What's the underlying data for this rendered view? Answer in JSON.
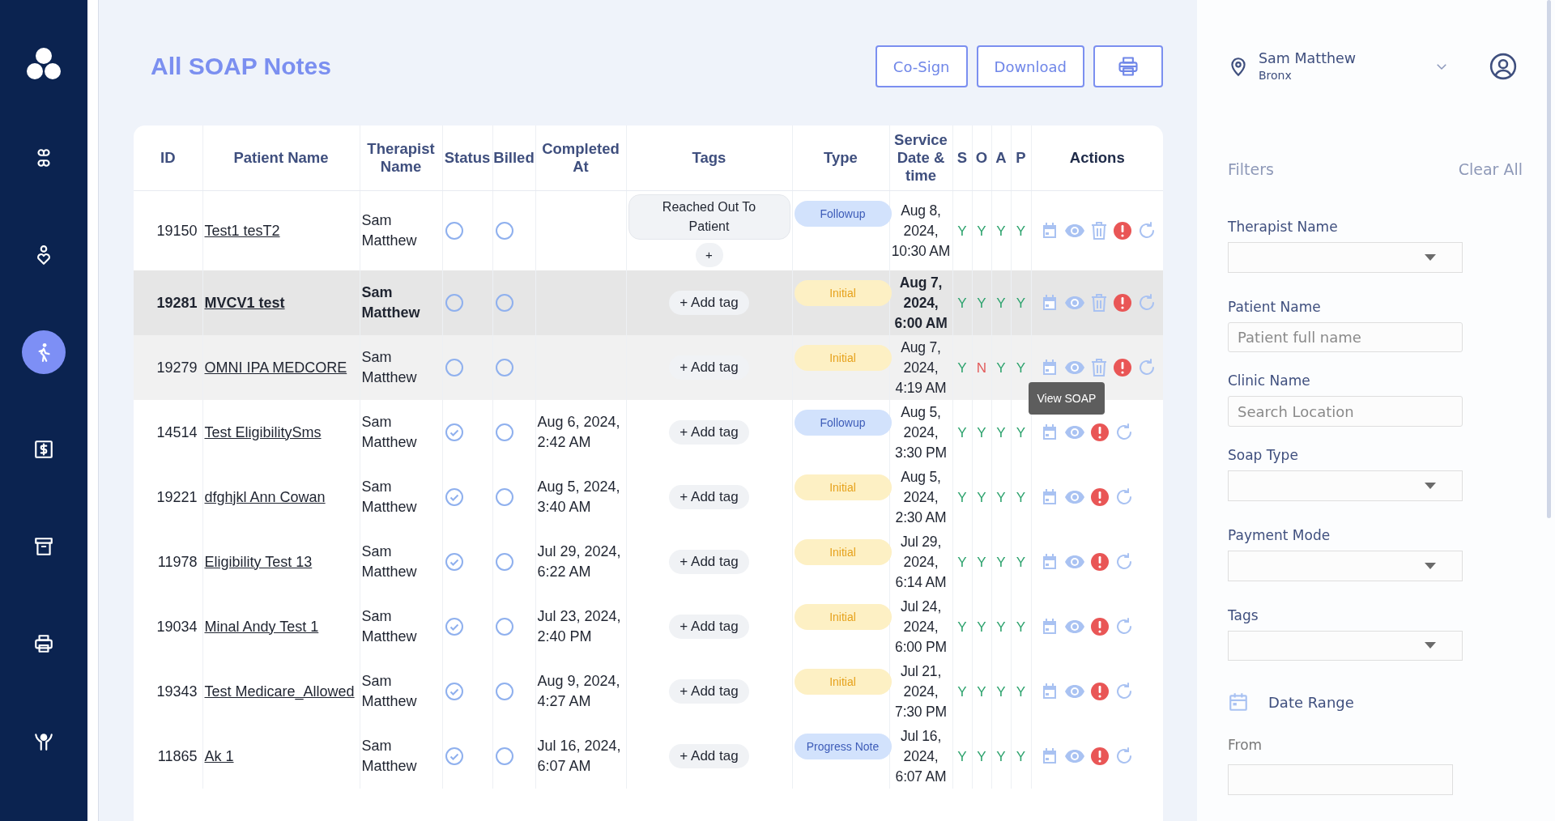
{
  "sidebar": {
    "items": [
      {
        "selected": false
      },
      {
        "selected": false
      },
      {
        "selected": true
      },
      {
        "selected": false
      },
      {
        "selected": false
      },
      {
        "selected": false
      },
      {
        "selected": false
      }
    ]
  },
  "page": {
    "title": "All SOAP Notes",
    "buttons": [
      "Co-Sign",
      "Download"
    ]
  },
  "table": {
    "columns": [
      "ID",
      "Patient Name",
      "Therapist Name",
      "Status",
      "Billed",
      "Completed At",
      "Tags",
      "Type",
      "Service Date & time",
      "S",
      "O",
      "A",
      "P",
      "Actions"
    ],
    "rows": [
      {
        "id": "19150",
        "patient": "Test1 tesT2",
        "therapist": "Sam Matthew",
        "completed": false,
        "billed": false,
        "tags": [
          "Reached Out To Patient"
        ],
        "add_label": "+",
        "type": {
          "label": "Followup",
          "color": "#d2e2fc"
        },
        "service": "Aug 8, 2024, 10:30 AM",
        "soap": [
          {
            "value": "Y",
            "ok": true
          },
          {
            "value": "Y",
            "ok": true
          },
          {
            "value": "Y",
            "ok": true
          },
          {
            "value": "Y",
            "ok": true
          }
        ],
        "can_delete": true,
        "selected": false,
        "hovered": false
      },
      {
        "id": "19281",
        "patient": "MVCV1 test",
        "therapist": "Sam Matthew",
        "completed": false,
        "billed": false,
        "add_label": "+ Add tag",
        "type": {
          "label": "Initial",
          "color": "#fdf0c4"
        },
        "service": "Aug 7, 2024, 6:00 AM",
        "soap": [
          {
            "value": "Y",
            "ok": true
          },
          {
            "value": "Y",
            "ok": true
          },
          {
            "value": "Y",
            "ok": true
          },
          {
            "value": "Y",
            "ok": true
          }
        ],
        "can_delete": true,
        "selected": true,
        "hovered": false
      },
      {
        "id": "19279",
        "patient": "OMNI IPA MEDCORE",
        "therapist": "Sam Matthew",
        "completed": false,
        "billed": false,
        "add_label": "+ Add tag",
        "type": {
          "label": "Initial",
          "color": "#fdf0c4"
        },
        "service": "Aug 7, 2024, 4:19 AM",
        "soap": [
          {
            "value": "Y",
            "ok": true
          },
          {
            "value": "N",
            "ok": false
          },
          {
            "value": "Y",
            "ok": true
          },
          {
            "value": "Y",
            "ok": true
          }
        ],
        "can_delete": true,
        "selected": false,
        "hovered": true,
        "tooltip": "View SOAP"
      },
      {
        "id": "14514",
        "patient": "Test EligibilitySms",
        "therapist": "Sam Matthew",
        "completed": true,
        "billed": false,
        "completed_at": "Aug 6, 2024, 2:42 AM",
        "add_label": "+ Add tag",
        "type": {
          "label": "Followup",
          "color": "#d2e2fc"
        },
        "service": "Aug 5, 2024, 3:30 PM",
        "soap": [
          {
            "value": "Y",
            "ok": true
          },
          {
            "value": "Y",
            "ok": true
          },
          {
            "value": "Y",
            "ok": true
          },
          {
            "value": "Y",
            "ok": true
          }
        ],
        "can_delete": false,
        "selected": false,
        "hovered": false
      },
      {
        "id": "19221",
        "patient": "dfghjkl Ann Cowan",
        "therapist": "Sam Matthew",
        "completed": true,
        "billed": false,
        "completed_at": "Aug 5, 2024, 3:40 AM",
        "add_label": "+ Add tag",
        "type": {
          "label": "Initial",
          "color": "#fdf0c4"
        },
        "service": "Aug 5, 2024, 2:30 AM",
        "soap": [
          {
            "value": "Y",
            "ok": true
          },
          {
            "value": "Y",
            "ok": true
          },
          {
            "value": "Y",
            "ok": true
          },
          {
            "value": "Y",
            "ok": true
          }
        ],
        "can_delete": false,
        "selected": false,
        "hovered": false
      },
      {
        "id": "11978",
        "patient": "Eligibility Test 13",
        "therapist": "Sam Matthew",
        "completed": true,
        "billed": false,
        "completed_at": "Jul 29, 2024, 6:22 AM",
        "add_label": "+ Add tag",
        "type": {
          "label": "Initial",
          "color": "#fdf0c4"
        },
        "service": "Jul 29, 2024, 6:14 AM",
        "soap": [
          {
            "value": "Y",
            "ok": true
          },
          {
            "value": "Y",
            "ok": true
          },
          {
            "value": "Y",
            "ok": true
          },
          {
            "value": "Y",
            "ok": true
          }
        ],
        "can_delete": false,
        "selected": false,
        "hovered": false
      },
      {
        "id": "19034",
        "patient": "Minal Andy Test 1",
        "therapist": "Sam Matthew",
        "completed": true,
        "billed": false,
        "completed_at": "Jul 23, 2024, 2:40 PM",
        "add_label": "+ Add tag",
        "type": {
          "label": "Initial",
          "color": "#fdf0c4"
        },
        "service": "Jul 24, 2024, 6:00 PM",
        "soap": [
          {
            "value": "Y",
            "ok": true
          },
          {
            "value": "Y",
            "ok": true
          },
          {
            "value": "Y",
            "ok": true
          },
          {
            "value": "Y",
            "ok": true
          }
        ],
        "can_delete": false,
        "selected": false,
        "hovered": false
      },
      {
        "id": "19343",
        "patient": "Test Medicare_Allowed",
        "therapist": "Sam Matthew",
        "completed": true,
        "billed": false,
        "completed_at": "Aug 9, 2024, 4:27 AM",
        "add_label": "+ Add tag",
        "type": {
          "label": "Initial",
          "color": "#fdf0c4"
        },
        "service": "Jul 21, 2024, 7:30 PM",
        "soap": [
          {
            "value": "Y",
            "ok": true
          },
          {
            "value": "Y",
            "ok": true
          },
          {
            "value": "Y",
            "ok": true
          },
          {
            "value": "Y",
            "ok": true
          }
        ],
        "can_delete": false,
        "selected": false,
        "hovered": false
      },
      {
        "id": "11865",
        "patient": "Ak 1",
        "therapist": "Sam Matthew",
        "completed": true,
        "billed": false,
        "completed_at": "Jul 16, 2024, 6:07 AM",
        "add_label": "+ Add tag",
        "type": {
          "label": "Progress Note",
          "color": "#d2e2fc"
        },
        "service": "Jul 16, 2024, 6:07 AM",
        "soap": [
          {
            "value": "Y",
            "ok": true
          },
          {
            "value": "Y",
            "ok": true
          },
          {
            "value": "Y",
            "ok": true
          },
          {
            "value": "Y",
            "ok": true
          }
        ],
        "can_delete": false,
        "selected": false,
        "hovered": false
      }
    ]
  },
  "user": {
    "name": "Sam Matthew",
    "location": "Bronx"
  },
  "filters": {
    "title": "Filters",
    "clear": "Clear All",
    "fields": [
      {
        "label": "Therapist Name",
        "kind": "select"
      },
      {
        "label": "Patient Name",
        "kind": "input",
        "placeholder": "Patient full name"
      },
      {
        "label": "Clinic Name",
        "kind": "input",
        "placeholder": "Search Location"
      },
      {
        "label": "Soap Type",
        "kind": "select"
      },
      {
        "label": "Payment Mode",
        "kind": "select"
      },
      {
        "label": "Tags",
        "kind": "select"
      }
    ],
    "date_range": {
      "label": "Date Range",
      "from": "From"
    }
  }
}
